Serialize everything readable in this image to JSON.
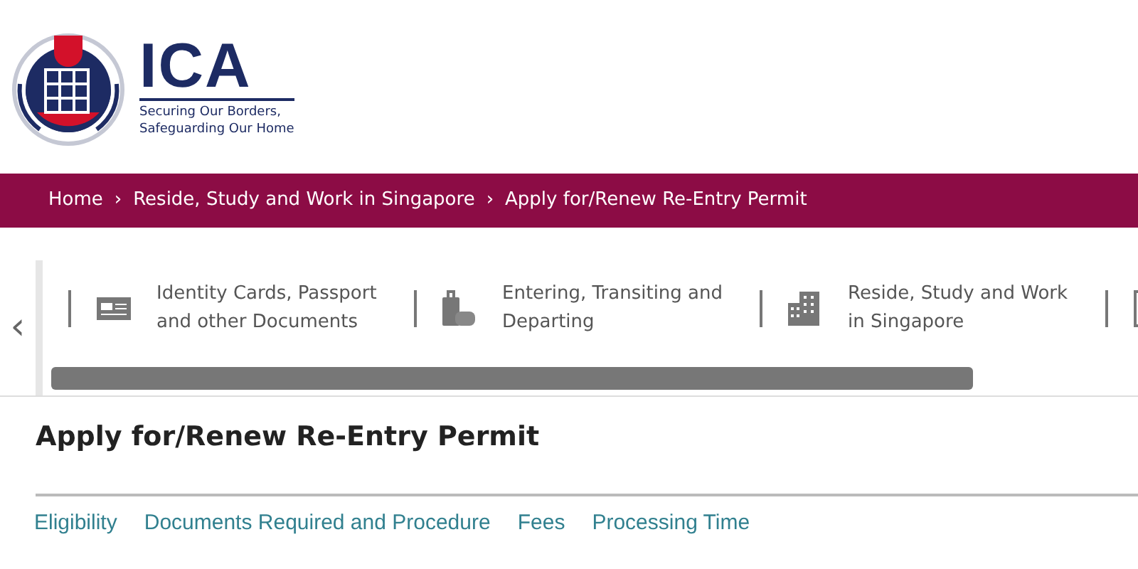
{
  "header": {
    "logo_text": "ICA",
    "tagline_lines": [
      "Securing Our Borders,",
      "Safeguarding Our Home"
    ]
  },
  "breadcrumb": [
    "Home",
    "Reside, Study and Work in Singapore",
    "Apply for/Renew Re-Entry Permit"
  ],
  "breadcrumb_separator": "›",
  "carousel": {
    "prev": "‹",
    "items": [
      {
        "kind": "card",
        "lines": [
          "Identity Cards, Passport",
          "and other Documents"
        ]
      },
      {
        "kind": "luggage",
        "lines": [
          "Entering, Transiting and",
          "Departing"
        ]
      },
      {
        "kind": "building",
        "lines": [
          "Reside, Study and Work",
          "in Singapore"
        ]
      },
      {
        "kind": "document"
      }
    ]
  },
  "page_title": "Apply for/Renew Re-Entry Permit",
  "section_links": [
    "Eligibility",
    "Documents Required and Procedure",
    "Fees",
    "Processing Time"
  ]
}
